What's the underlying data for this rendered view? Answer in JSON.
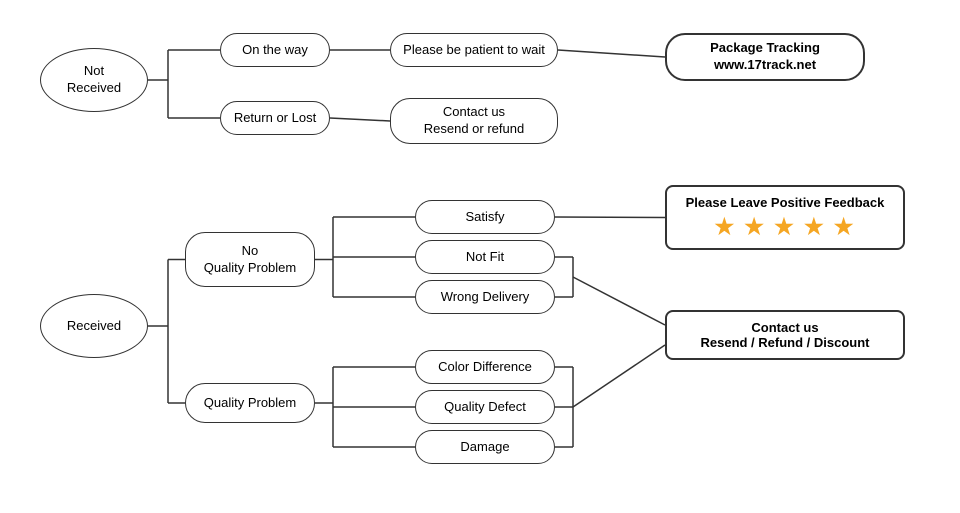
{
  "nodes": {
    "not_received": {
      "label": "Not\nReceived"
    },
    "on_the_way": {
      "label": "On the way"
    },
    "return_or_lost": {
      "label": "Return or Lost"
    },
    "be_patient": {
      "label": "Please be patient to wait"
    },
    "contact_resend": {
      "label": "Contact us\nResend or refund"
    },
    "package_tracking": {
      "label": "Package Tracking\nwww.17track.net"
    },
    "received": {
      "label": "Received"
    },
    "no_quality_problem": {
      "label": "No\nQuality Problem"
    },
    "quality_problem": {
      "label": "Quality Problem"
    },
    "satisfy": {
      "label": "Satisfy"
    },
    "not_fit": {
      "label": "Not Fit"
    },
    "wrong_delivery": {
      "label": "Wrong Delivery"
    },
    "color_difference": {
      "label": "Color Difference"
    },
    "quality_defect": {
      "label": "Quality Defect"
    },
    "damage": {
      "label": "Damage"
    },
    "positive_feedback": {
      "label": "Please Leave Positive Feedback"
    },
    "stars": {
      "label": "★ ★ ★ ★ ★"
    },
    "contact_us2": {
      "label": "Contact us\nResend / Refund / Discount"
    }
  }
}
